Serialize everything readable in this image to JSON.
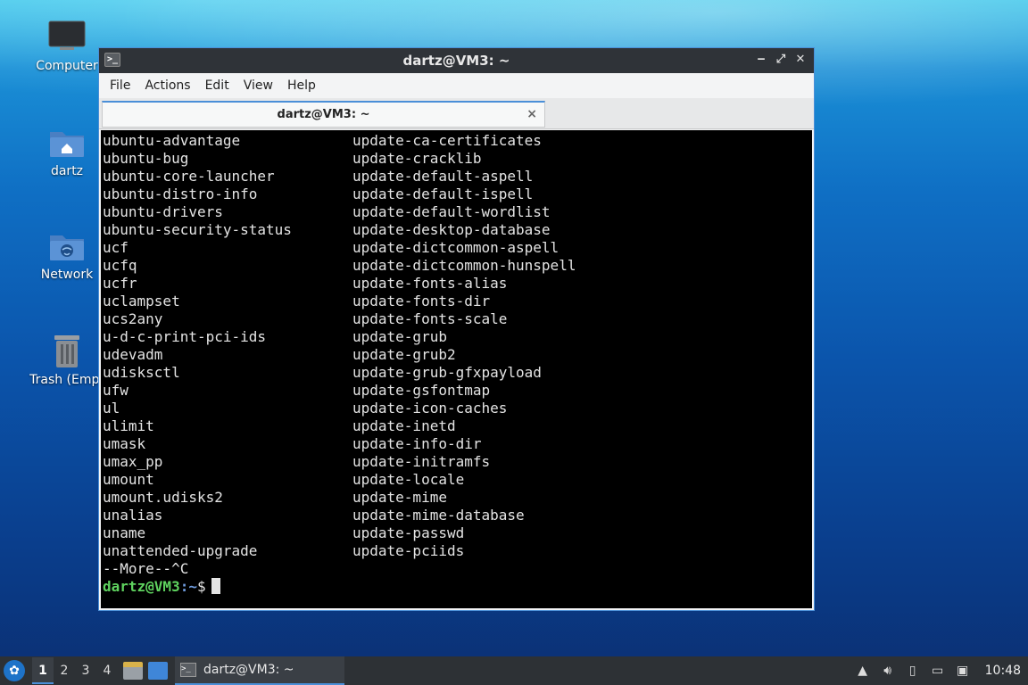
{
  "desktop": {
    "icons": [
      {
        "label": "Computer",
        "icon": "monitor-icon"
      },
      {
        "label": "dartz",
        "icon": "home-folder-icon"
      },
      {
        "label": "Network",
        "icon": "network-folder-icon"
      },
      {
        "label": "Trash (Empt",
        "icon": "trash-icon"
      }
    ]
  },
  "window": {
    "title": "dartz@VM3: ~",
    "menu": [
      "File",
      "Actions",
      "Edit",
      "View",
      "Help"
    ],
    "tab_label": "dartz@VM3: ~",
    "tab_close": "×",
    "controls": {
      "minimize": "‒",
      "maximize": "⤢",
      "close": "✕"
    }
  },
  "terminal": {
    "col_a": [
      "ubuntu-advantage",
      "ubuntu-bug",
      "ubuntu-core-launcher",
      "ubuntu-distro-info",
      "ubuntu-drivers",
      "ubuntu-security-status",
      "ucf",
      "ucfq",
      "ucfr",
      "uclampset",
      "ucs2any",
      "u-d-c-print-pci-ids",
      "udevadm",
      "udisksctl",
      "ufw",
      "ul",
      "ulimit",
      "umask",
      "umax_pp",
      "umount",
      "umount.udisks2",
      "unalias",
      "uname",
      "unattended-upgrade"
    ],
    "col_b": [
      "update-ca-certificates",
      "update-cracklib",
      "update-default-aspell",
      "update-default-ispell",
      "update-default-wordlist",
      "update-desktop-database",
      "update-dictcommon-aspell",
      "update-dictcommon-hunspell",
      "update-fonts-alias",
      "update-fonts-dir",
      "update-fonts-scale",
      "update-grub",
      "update-grub2",
      "update-grub-gfxpayload",
      "update-gsfontmap",
      "update-icon-caches",
      "update-inetd",
      "update-info-dir",
      "update-initramfs",
      "update-locale",
      "update-mime",
      "update-mime-database",
      "update-passwd",
      "update-pciids"
    ],
    "more_line": "--More--^C",
    "prompt_user": "dartz@VM3",
    "prompt_sep": ":",
    "prompt_path": "~",
    "prompt_symbol": "$"
  },
  "taskbar": {
    "workspaces": [
      "1",
      "2",
      "3",
      "4"
    ],
    "active_workspace": "1",
    "task_label": "dartz@VM3: ~",
    "clock": "10:48"
  },
  "colors": {
    "accent": "#4a8fd8",
    "prompt_user": "#5fd35f",
    "prompt_path": "#6f9bdd"
  }
}
